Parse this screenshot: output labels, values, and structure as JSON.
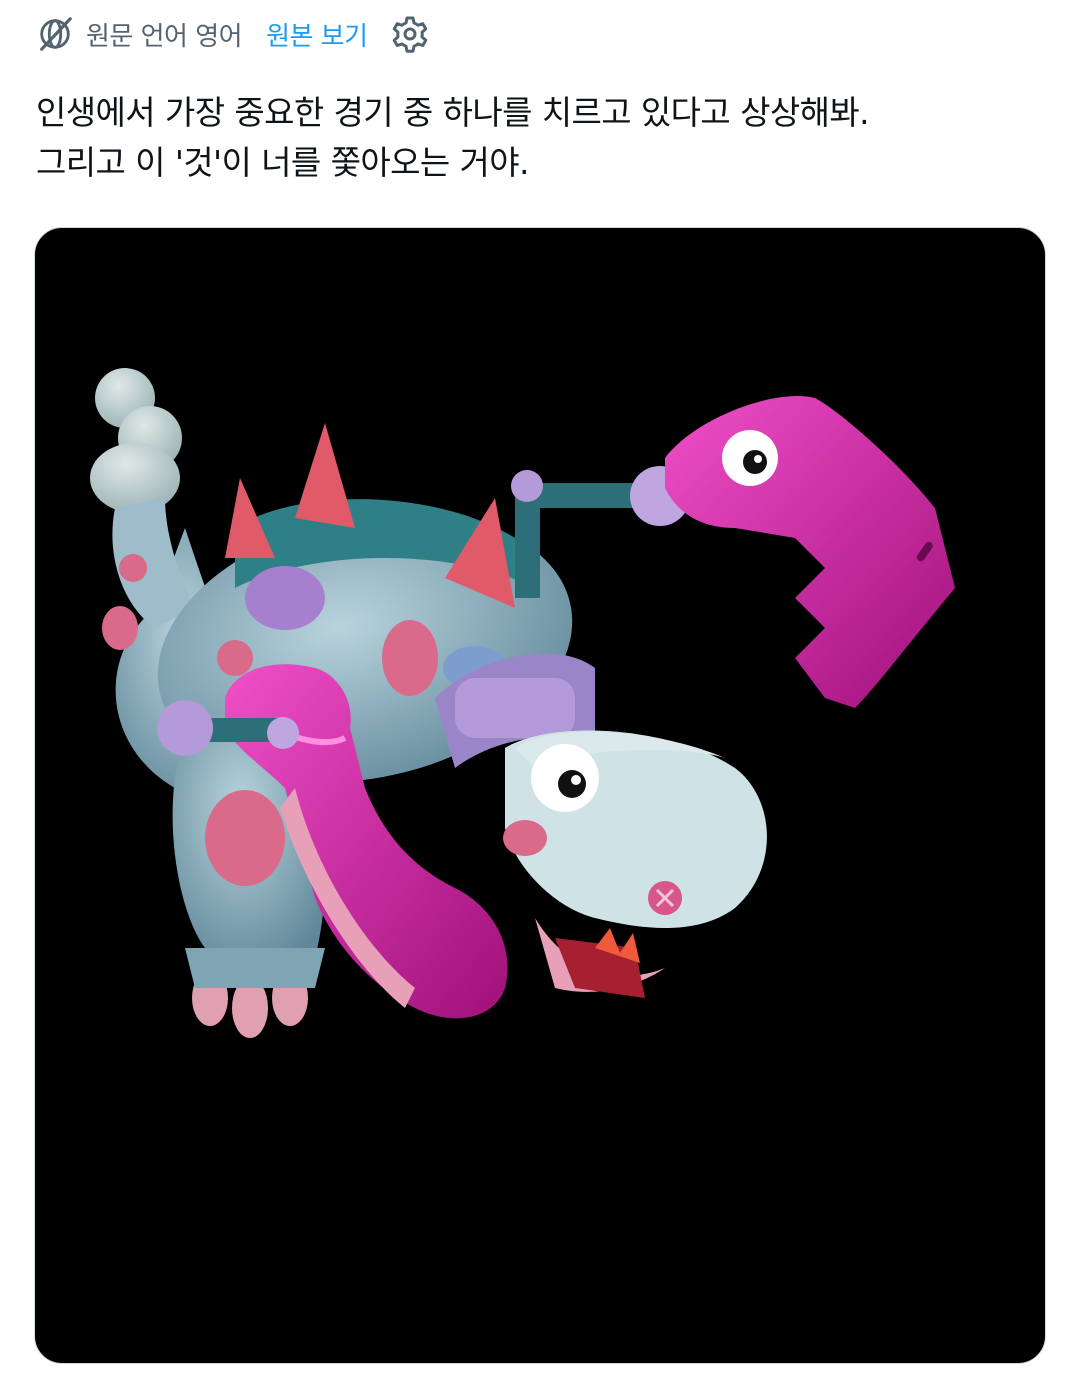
{
  "translation_bar": {
    "icon": "globe-translate-icon",
    "label": "원문 언어 영어",
    "view_original_label": "원본 보기",
    "settings_icon": "gear-icon"
  },
  "tweet": {
    "lines": [
      "인생에서 가장 중요한 경기 중 하나를 치르고 있다고 상상해봐.",
      "그리고 이 '것'이 너를 쫓아오는 거야."
    ]
  },
  "media": {
    "kind": "image",
    "subject": "dinosaur-creature-illustration",
    "background_color": "#000000"
  },
  "colors": {
    "link": "#1d9bf0",
    "secondary_text": "#536471",
    "magenta": "#d81b9c",
    "body_blue": "#8fb4c4"
  }
}
